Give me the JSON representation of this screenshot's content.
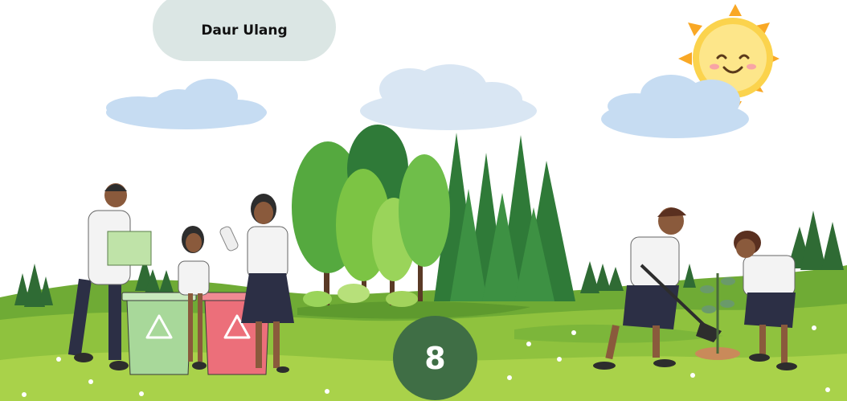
{
  "header": {
    "title": "Daur Ulang"
  },
  "page": {
    "number": "8"
  },
  "scene": {
    "sky": "#ffffff",
    "grass_light": "#a9d24a",
    "grass_mid": "#7cb63a",
    "grass_dark": "#5e9a2e",
    "tree_light": "#7cc444",
    "tree_dark": "#2f7a38",
    "sun": "#fbc02d",
    "cloud": "#c6dcf2",
    "bin_green": "#a8d89a",
    "bin_red": "#ec6f7a",
    "badge": "#3f6e45"
  }
}
